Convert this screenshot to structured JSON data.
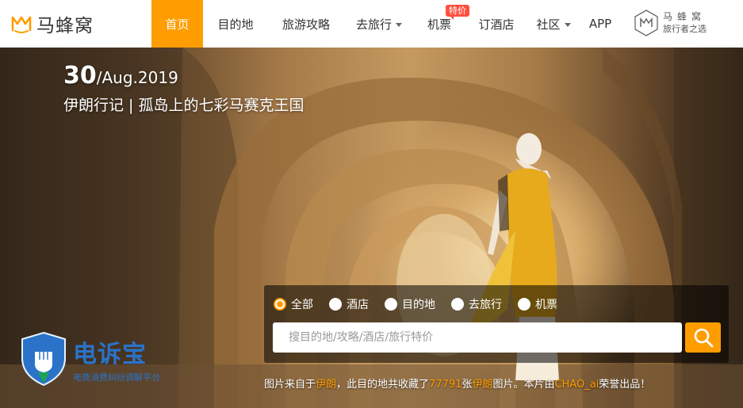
{
  "logo": {
    "text": "马蜂窝"
  },
  "nav": {
    "items": [
      {
        "label": "首页",
        "active": true,
        "width": 65
      },
      {
        "label": "目的地",
        "width": 82
      },
      {
        "label": "旅游攻略",
        "width": 96
      },
      {
        "label": "去旅行",
        "dropdown": true,
        "width": 88
      },
      {
        "label": "机票",
        "badge": "特价",
        "width": 64
      },
      {
        "label": "订酒店",
        "width": 80
      },
      {
        "label": "社区",
        "dropdown": true,
        "width": 64
      },
      {
        "label": "APP",
        "width": 54
      }
    ]
  },
  "brand_tag": {
    "line1": "马蜂窝",
    "line2": "旅行者之选"
  },
  "hero": {
    "date_day": "30",
    "date_rest": "/Aug.2019",
    "title": "伊朗行记 | 孤岛上的七彩马赛克王国"
  },
  "search": {
    "options": [
      {
        "label": "全部",
        "checked": true
      },
      {
        "label": "酒店"
      },
      {
        "label": "目的地"
      },
      {
        "label": "去旅行"
      },
      {
        "label": "机票"
      }
    ],
    "placeholder": "搜目的地/攻略/酒店/旅行特价"
  },
  "credit": {
    "p1": "图片来自于",
    "place": "伊朗",
    "p2": "，此目的地共收藏了",
    "count": "77791",
    "p3": "张",
    "place2": "伊朗",
    "p4": "图片。本片由",
    "author": "CHAO_ai",
    "p5": "荣誉出品！"
  },
  "watermark": {
    "text": "电诉宝",
    "sub": "电商消费纠纷调解平台"
  },
  "colors": {
    "accent": "#ff9d00",
    "badge": "#ff4f3f",
    "watermark": "#2a73c9"
  },
  "icons": {
    "search": "magnifier-icon",
    "logo": "mafengwo-m-icon"
  }
}
